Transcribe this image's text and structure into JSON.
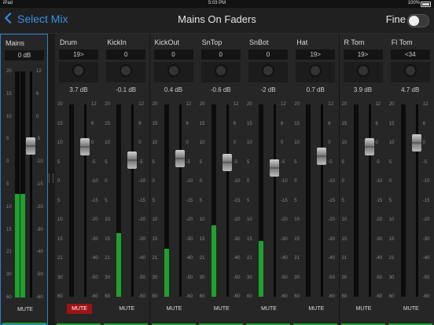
{
  "status": {
    "left": "iPad",
    "time": "5:03 PM",
    "battery": "100%"
  },
  "nav": {
    "back_label": "Select Mix",
    "title": "Mains On Faders",
    "fine_label": "Fine",
    "fine_on": false
  },
  "scales": {
    "left": [
      "20",
      "15",
      "10",
      "5",
      "0",
      "5",
      "10",
      "15",
      "21",
      "30",
      "60"
    ],
    "right": [
      "12",
      "6",
      "0",
      "-5",
      "-10",
      "-15",
      "-20",
      "-30",
      "-40",
      "-50",
      "-60"
    ]
  },
  "main": {
    "name": "Mains",
    "value": "0 dB",
    "mute_label": "MUTE",
    "muted": false,
    "meter": 0.46,
    "fader": 0.33
  },
  "channels": [
    {
      "name": "Drum",
      "pan": "19>",
      "gain": "3.7 dB",
      "mute_label": "MUTE",
      "muted": true,
      "meter": 0.0,
      "fader": 0.22
    },
    {
      "name": "KickIn",
      "pan": "0",
      "gain": "-0.1 dB",
      "mute_label": "MUTE",
      "muted": false,
      "meter": 0.33,
      "fader": 0.29
    },
    {
      "name": "KickOut",
      "pan": "0",
      "gain": "0.4 dB",
      "mute_label": "MUTE",
      "muted": false,
      "meter": 0.25,
      "fader": 0.28
    },
    {
      "name": "SnTop",
      "pan": "0",
      "gain": "-0.6 dB",
      "mute_label": "MUTE",
      "muted": false,
      "meter": 0.37,
      "fader": 0.3
    },
    {
      "name": "SnBot",
      "pan": "0",
      "gain": "-2 dB",
      "mute_label": "MUTE",
      "muted": false,
      "meter": 0.29,
      "fader": 0.33
    },
    {
      "name": "Hat",
      "pan": "19>",
      "gain": "0.7 dB",
      "mute_label": "MUTE",
      "muted": false,
      "meter": 0.0,
      "fader": 0.27
    },
    {
      "name": "R Tom",
      "pan": "19>",
      "gain": "3.9 dB",
      "mute_label": "MUTE",
      "muted": false,
      "meter": 0.0,
      "fader": 0.22
    },
    {
      "name": "Fl Tom",
      "pan": "<34",
      "gain": "4.7 dB",
      "mute_label": "MUTE",
      "muted": false,
      "meter": 0.0,
      "fader": 0.2
    }
  ],
  "colors": {
    "accent": "#2e7fd6",
    "meter": "#1ea12d",
    "mute_on": "#9b1414"
  }
}
